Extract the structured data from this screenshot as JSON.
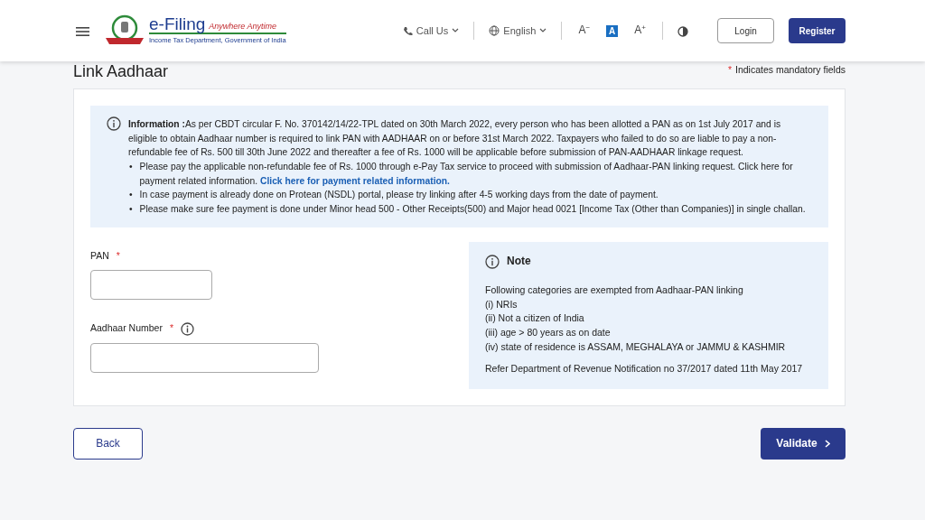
{
  "header": {
    "logo": {
      "title": "e-Filing",
      "tagline": "Anywhere Anytime",
      "subtitle": "Income Tax Department, Government of India"
    },
    "call_us": "Call Us",
    "language": "English",
    "font_sizes": [
      {
        "label": "A",
        "sign": "−",
        "selected": false
      },
      {
        "label": "A",
        "selected": true
      },
      {
        "label": "A",
        "sign": "+",
        "selected": false
      }
    ],
    "login": "Login",
    "register": "Register"
  },
  "page": {
    "title": "Link Aadhaar",
    "mandatory_mark": "*",
    "mandatory_note": "Indicates mandatory fields"
  },
  "information": [
    {
      "text": "**Information :**As per CBDT circular F. No. 370142/14/22-TPL dated on 30th March 2022, every person who has been allotted a PAN as on 1st July 2017 and is eligible to obtain Aadhaar number is required to link PAN with AADHAAR on or before 31st March 2022. Taxpayers who failed to do so are liable to pay a non-refundable fee of Rs. 500 till 30th June 2022 and thereafter a fee of Rs. 1000 will be applicable before submission of PAN-AADHAAR linkage request."
    },
    {
      "bullet": "•",
      "text": "Please pay the applicable non-refundable fee of Rs. 1000 through e-Pay Tax service to proceed with submission of Aadhaar-PAN linking request. Click here for payment related information.",
      "link": "Click here for payment related information."
    },
    {
      "bullet": "•",
      "text": "In case payment is already done on Protean (NSDL) portal, please try linking after 4-5 working days from the date of payment."
    },
    {
      "bullet": "•",
      "text": "Please make sure fee payment is done under Minor head 500 - Other Receipts(500) and Major head 0021 [Income Tax (Other than Companies)] in single challan."
    }
  ],
  "fields": [
    {
      "label": "PAN",
      "required": true,
      "info": false
    },
    {
      "label": "Aadhaar Number",
      "required": true,
      "info": true
    }
  ],
  "note": {
    "title": "Note",
    "lines": [
      "Following categories are exempted from Aadhaar-PAN linking",
      "(i) NRIs",
      "(ii) Not a citizen of India",
      "(iii) age > 80 years as on date",
      "(iv) state of residence is ASSAM, MEGHALAYA or JAMMU & KASHMIR"
    ],
    "reference": "Refer Department of Revenue Notification no 37/2017 dated 11th May 2017"
  },
  "buttons": {
    "back": "Back",
    "validate": "Validate"
  }
}
